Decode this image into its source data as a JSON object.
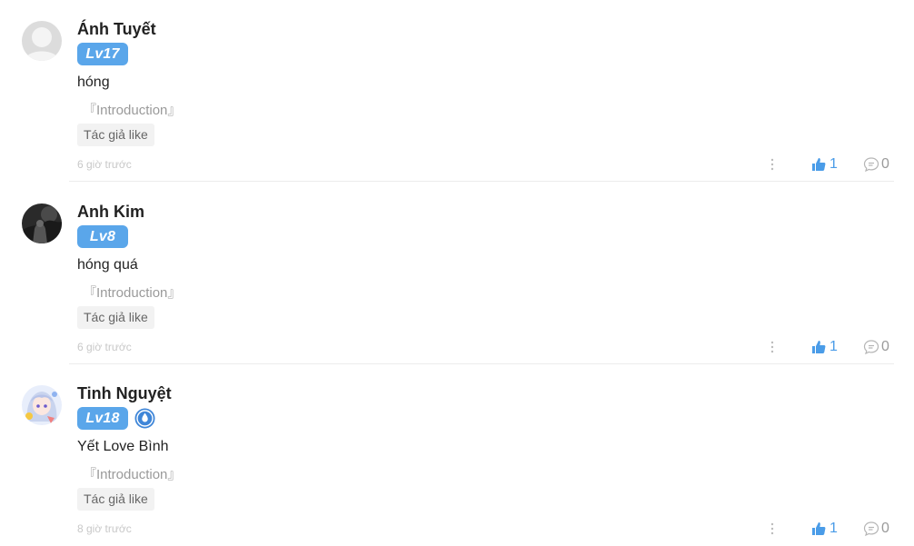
{
  "comments": [
    {
      "avatar": "avatar-placeholder",
      "username": "Ánh Tuyết",
      "level": "Lv17",
      "text": "hóng",
      "intro": "『Introduction』",
      "tag": "Tác giả like",
      "time": "6 giờ trước",
      "likes": "1",
      "replies": "0"
    },
    {
      "avatar": "avatar-dark-photo",
      "username": "Anh Kim",
      "level": "Lv8",
      "text": "hóng quá",
      "intro": "『Introduction』",
      "tag": "Tác giả like",
      "time": "6 giờ trước",
      "likes": "1",
      "replies": "0"
    },
    {
      "avatar": "avatar-anime-girl",
      "username": "Tinh Nguyệt",
      "level": "Lv18",
      "vip_icon": "droplet-badge-icon",
      "text": "Yết Love Bình",
      "intro": "『Introduction』",
      "tag": "Tác giả like",
      "time": "8 giờ trước",
      "likes": "1",
      "replies": "0"
    }
  ],
  "colors": {
    "accent": "#5aa6ea",
    "like": "#4a9ce8",
    "muted": "#9a9a9a"
  }
}
